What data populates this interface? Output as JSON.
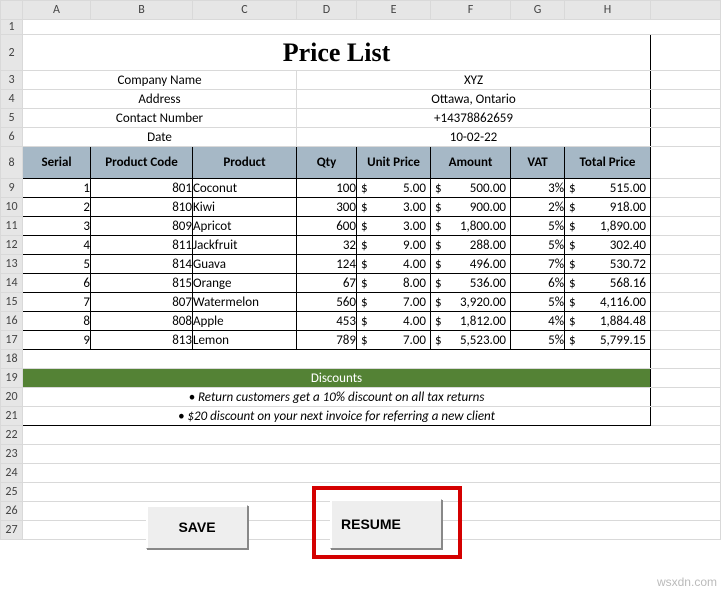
{
  "columns": [
    "A",
    "B",
    "C",
    "D",
    "E",
    "F",
    "G",
    "H"
  ],
  "title": "Price List",
  "info": {
    "labels": [
      "Company Name",
      "Address",
      "Contact Number",
      "Date"
    ],
    "values": [
      "XYZ",
      "Ottawa, Ontario",
      "+14378862659",
      "10-02-22"
    ]
  },
  "headers": [
    "Serial",
    "Product Code",
    "Product",
    "Qty",
    "Unit Price",
    "Amount",
    "VAT",
    "Total Price"
  ],
  "rows": [
    {
      "serial": "1",
      "code": "801",
      "product": "Coconut",
      "qty": "100",
      "unit": "5.00",
      "amount": "500.00",
      "vat": "3%",
      "total": "515.00"
    },
    {
      "serial": "2",
      "code": "810",
      "product": "Kiwi",
      "qty": "300",
      "unit": "3.00",
      "amount": "900.00",
      "vat": "2%",
      "total": "918.00"
    },
    {
      "serial": "3",
      "code": "809",
      "product": "Apricot",
      "qty": "600",
      "unit": "3.00",
      "amount": "1,800.00",
      "vat": "5%",
      "total": "1,890.00"
    },
    {
      "serial": "4",
      "code": "811",
      "product": "Jackfruit",
      "qty": "32",
      "unit": "9.00",
      "amount": "288.00",
      "vat": "5%",
      "total": "302.40"
    },
    {
      "serial": "5",
      "code": "814",
      "product": "Guava",
      "qty": "124",
      "unit": "4.00",
      "amount": "496.00",
      "vat": "7%",
      "total": "530.72"
    },
    {
      "serial": "6",
      "code": "815",
      "product": "Orange",
      "qty": "67",
      "unit": "8.00",
      "amount": "536.00",
      "vat": "6%",
      "total": "568.16"
    },
    {
      "serial": "7",
      "code": "807",
      "product": "Watermelon",
      "qty": "560",
      "unit": "7.00",
      "amount": "3,920.00",
      "vat": "5%",
      "total": "4,116.00"
    },
    {
      "serial": "8",
      "code": "808",
      "product": "Apple",
      "qty": "453",
      "unit": "4.00",
      "amount": "1,812.00",
      "vat": "4%",
      "total": "1,884.48"
    },
    {
      "serial": "9",
      "code": "813",
      "product": "Lemon",
      "qty": "789",
      "unit": "7.00",
      "amount": "5,523.00",
      "vat": "5%",
      "total": "5,799.15"
    }
  ],
  "discounts": {
    "header": "Discounts",
    "lines": [
      "• Return customers get a 10% discount on all tax returns",
      "• $20 discount on your next invoice for referring a new client"
    ]
  },
  "buttons": {
    "save": "SAVE",
    "resume": "RESUME"
  },
  "row_headers": [
    "1",
    "2",
    "3",
    "4",
    "5",
    "6",
    "8",
    "9",
    "10",
    "11",
    "12",
    "13",
    "14",
    "15",
    "16",
    "17",
    "18",
    "19",
    "20",
    "21",
    "22",
    "23",
    "24",
    "25",
    "26",
    "27"
  ],
  "currency": "$",
  "watermark": "wsxdn.com"
}
